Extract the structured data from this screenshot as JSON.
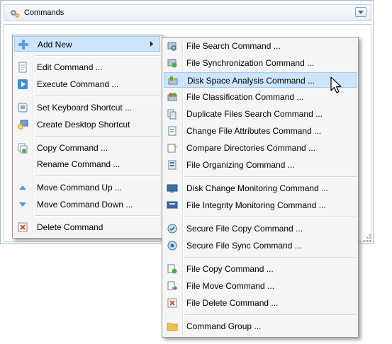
{
  "window": {
    "title": "Commands"
  },
  "context_menu": {
    "items": [
      {
        "label": "Add New",
        "icon": "plus-icon",
        "has_submenu": true,
        "highlighted": true
      },
      {
        "label": "Edit Command ...",
        "icon": "edit-icon"
      },
      {
        "label": "Execute Command ...",
        "icon": "play-icon"
      },
      {
        "label": "Set Keyboard Shortcut ...",
        "icon": "keyboard-icon"
      },
      {
        "label": "Create Desktop Shortcut",
        "icon": "desktop-shortcut-icon"
      },
      {
        "label": "Copy Command ...",
        "icon": "copy-icon"
      },
      {
        "label": "Rename Command ...",
        "icon": ""
      },
      {
        "label": "Move Command Up ...",
        "icon": "arrow-up-icon"
      },
      {
        "label": "Move Command Down ...",
        "icon": "arrow-down-icon"
      },
      {
        "label": "Delete Command",
        "icon": "delete-icon"
      }
    ]
  },
  "submenu": {
    "items": [
      {
        "label": "File Search Command ...",
        "icon": "file-search-icon"
      },
      {
        "label": "File Synchronization Command ...",
        "icon": "file-sync-icon"
      },
      {
        "label": "Disk Space Analysis Command ...",
        "icon": "disk-space-icon",
        "highlighted": true
      },
      {
        "label": "File Classification Command ...",
        "icon": "file-classification-icon"
      },
      {
        "label": "Duplicate Files Search Command ...",
        "icon": "duplicate-files-icon"
      },
      {
        "label": "Change File Attributes Command ...",
        "icon": "file-attributes-icon"
      },
      {
        "label": "Compare Directories Command ...",
        "icon": "compare-directories-icon"
      },
      {
        "label": "File Organizing Command ...",
        "icon": "file-organizing-icon"
      },
      {
        "label": "Disk Change Monitoring Command ...",
        "icon": "disk-monitor-icon"
      },
      {
        "label": "File Integrity Monitoring Command ...",
        "icon": "integrity-monitor-icon"
      },
      {
        "label": "Secure File Copy Command ...",
        "icon": "secure-copy-icon"
      },
      {
        "label": "Secure File Sync Command ...",
        "icon": "secure-sync-icon"
      },
      {
        "label": "File Copy Command ...",
        "icon": "file-copy-icon"
      },
      {
        "label": "File Move Command ...",
        "icon": "file-move-icon"
      },
      {
        "label": "File Delete Command ...",
        "icon": "file-delete-icon"
      },
      {
        "label": "Command Group ...",
        "icon": "folder-icon"
      }
    ]
  },
  "colors": {
    "highlight_bg": "#cde4fb",
    "highlight_border": "#9fcbf5",
    "menu_bg": "#f5f5f5"
  }
}
